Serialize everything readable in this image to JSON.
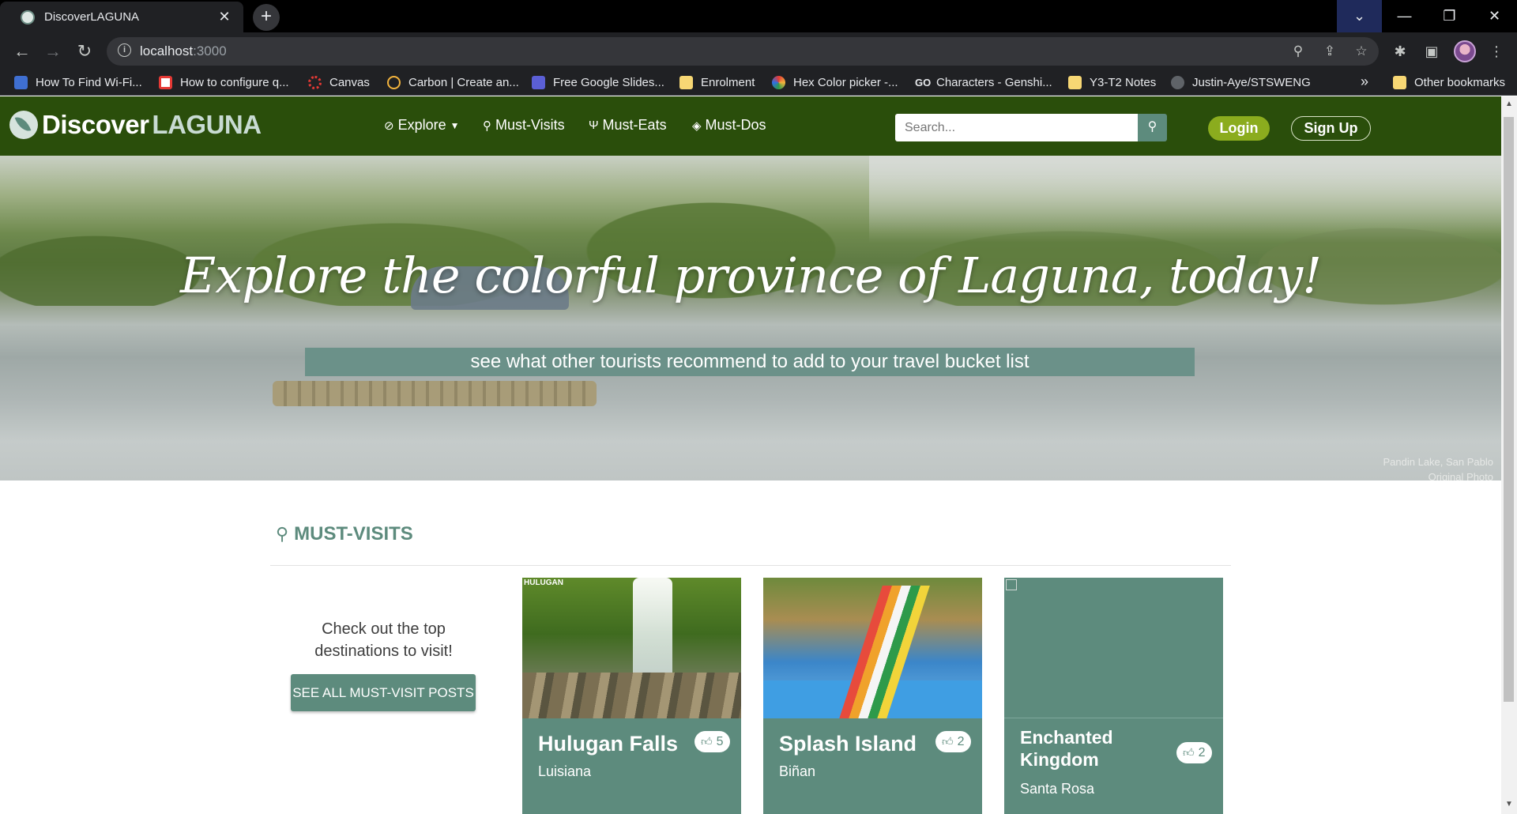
{
  "browser": {
    "tab_title": "DiscoverLAGUNA",
    "url_host": "localhost",
    "url_port": ":3000",
    "bookmarks": [
      {
        "label": "How To Find Wi-Fi...",
        "color": "#3f6fd1"
      },
      {
        "label": "How to configure q...",
        "color": "#e53935"
      },
      {
        "label": "Canvas",
        "color": "#e53935"
      },
      {
        "label": "Carbon | Create an...",
        "color": "#f2b33d"
      },
      {
        "label": "Free Google Slides...",
        "color": "#5b5fd6"
      },
      {
        "label": "Enrolment",
        "color": "#f7d774"
      },
      {
        "label": "Hex Color picker -...",
        "color": "#2f6fe4"
      },
      {
        "label": "Characters - Genshi...",
        "color": "#e8eaed"
      },
      {
        "label": "Y3-T2 Notes",
        "color": "#f7d774"
      },
      {
        "label": "Justin-Aye/STSWENG",
        "color": "#9aa0a6"
      }
    ],
    "other_bookmarks": "Other bookmarks",
    "more_chevron": "»"
  },
  "site": {
    "logo_part1": "Discover",
    "logo_part2": "LAGUNA",
    "nav": {
      "explore": "Explore",
      "must_visits": "Must-Visits",
      "must_eats": "Must-Eats",
      "must_dos": "Must-Dos"
    },
    "search_placeholder": "Search...",
    "login": "Login",
    "signup": "Sign Up",
    "brand_color": "#2a4e0b",
    "accent_color": "#5d8b7d"
  },
  "hero": {
    "title": "Explore the colorful province of Laguna, today!",
    "subtitle": "see what other tourists recommend to add to your travel bucket list",
    "caption_line1": "Pandin Lake, San Pablo",
    "caption_line2": "Original Photo"
  },
  "must_visits": {
    "heading": "MUST-VISITS",
    "intro": "Check out the top destinations to visit!",
    "see_all": "SEE ALL MUST-VISIT POSTS",
    "cards": [
      {
        "title": "Hulugan Falls",
        "location": "Luisiana",
        "likes": "5",
        "brand_text": "HULUGAN"
      },
      {
        "title": "Splash Island",
        "location": "Biñan",
        "likes": "2"
      },
      {
        "title": "Enchanted Kingdom",
        "location": "Santa Rosa",
        "likes": "2"
      }
    ]
  }
}
